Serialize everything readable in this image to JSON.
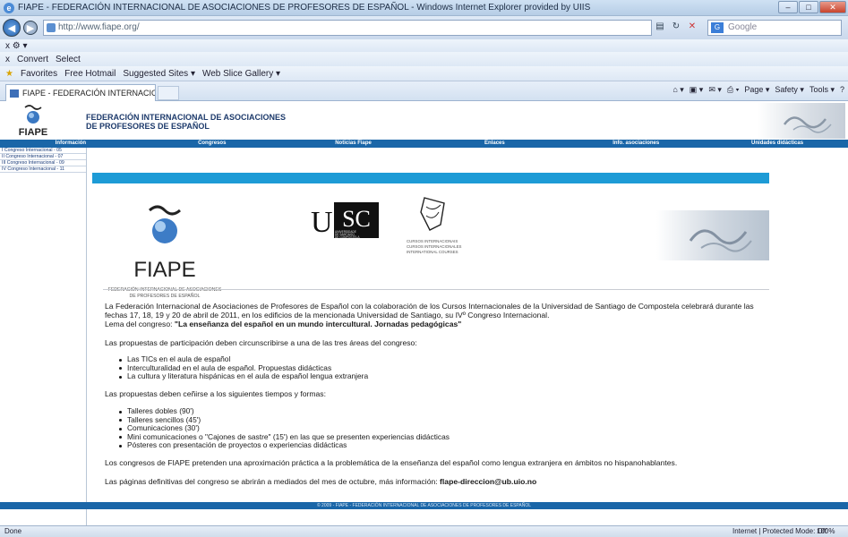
{
  "browser": {
    "window_title": "FIAPE - FEDERACIÓN INTERNACIONAL DE ASOCIACIONES DE PROFESORES DE ESPAÑOL - Windows Internet Explorer provided by UIIS",
    "address": "http://www.fiape.org/",
    "search_placeholder": "Google",
    "toolbar_row1": "x  ⚙ ▾",
    "convert_label": "Convert",
    "select_label": "Select",
    "favorites_label": "Favorites",
    "hotmail_label": "Free Hotmail",
    "suggested_label": "Suggested Sites ▾",
    "webslice_label": "Web Slice Gallery ▾",
    "tab_label": "FIAPE - FEDERACIÓN INTERNACIONAL DE ASOCI...",
    "cmd_page": "Page ▾",
    "cmd_safety": "Safety ▾",
    "cmd_tools": "Tools ▾",
    "status_done": "Done",
    "status_zone": "Internet | Protected Mode: Off",
    "status_zoom": "100%"
  },
  "header": {
    "logo_text": "FIAPE",
    "title_line1": "FEDERACIÓN INTERNACIONAL DE ASOCIACIONES",
    "title_line2": "DE PROFESORES DE ESPAÑOL"
  },
  "nav": {
    "items": [
      {
        "label": "Información"
      },
      {
        "label": "Congresos"
      },
      {
        "label": "Noticias Fiape"
      },
      {
        "label": "Enlaces"
      },
      {
        "label": "Info. asociaciones"
      },
      {
        "label": "Unidades didácticas"
      }
    ]
  },
  "sidebar": {
    "items": [
      {
        "label": "I Congreso Internacional - 05"
      },
      {
        "label": "II Congreso Internacional - 07"
      },
      {
        "label": "III Congreso Internacional - 09"
      },
      {
        "label": "IV Congreso Internacional - 11"
      }
    ]
  },
  "logos": {
    "fiape_big": "FIAPE",
    "fiape_sub1": "FEDERACIÓN INTERNACIONAL DE ASOCIACIONES",
    "fiape_sub2": "DE PROFESORES DE ESPAÑOL",
    "usc": "USC",
    "usc_sub1": "UNIVERSIDADE",
    "usc_sub2": "DE SANTIAGO",
    "usc_sub3": "DE COMPOSTELA",
    "cursos_1": "CURSOS INTERNACIONAIS",
    "cursos_2": "CURSOS INTERNACIONALES",
    "cursos_3": "INTERNATIONAL COURSES"
  },
  "content": {
    "p1_line1": "La Federación Internacional de Asociaciones de Profesores de Español con la colaboración de los Cursos Internacionales de la Universidad de Santiago de Compostela celebrará durante las",
    "p1_line2": "fechas 17, 18, 19 y 20 de abril de 2011, en los edificios de la mencionada Universidad de Santiago, su IVº Congreso Internacional.",
    "p1_line3_prefix": "Lema del congreso: ",
    "p1_line3_bold": "\"La enseñanza del español en un mundo intercultural. Jornadas pedagógicas\"",
    "p2": "Las propuestas de participación deben circunscribirse a una de las tres áreas del congreso:",
    "areas": [
      "Las TICs en el aula de español",
      "Interculturalidad en el aula de español. Propuestas didácticas",
      "La cultura y literatura hispánicas en el aula de español lengua extranjera"
    ],
    "p3": "Las propuestas deben ceñirse a los siguientes tiempos y formas:",
    "formats": [
      "Talleres dobles (90')",
      "Talleres sencillos (45')",
      "Comunicaciones (30')",
      "Mini comunicaciones o \"Cajones de sastre\" (15') en las que se presenten experiencias didácticas",
      "Pósteres con presentación de proyectos o experiencias didácticas"
    ],
    "p4": "Los congresos de FIAPE pretenden una aproximación práctica a la problemática de la enseñanza del español como lengua extranjera en ámbitos no hispanohablantes.",
    "p5_prefix": "Las páginas definitivas del congreso se abrirán a mediados del mes de octubre, más información: ",
    "p5_email": "flape-direccion@ub.uio.no"
  },
  "footer": {
    "text": "© 2009 - FIAPE - FEDERACIÓN INTERNACIONAL DE ASOCIACIONES DE PROFESORES DE ESPAÑOL"
  }
}
